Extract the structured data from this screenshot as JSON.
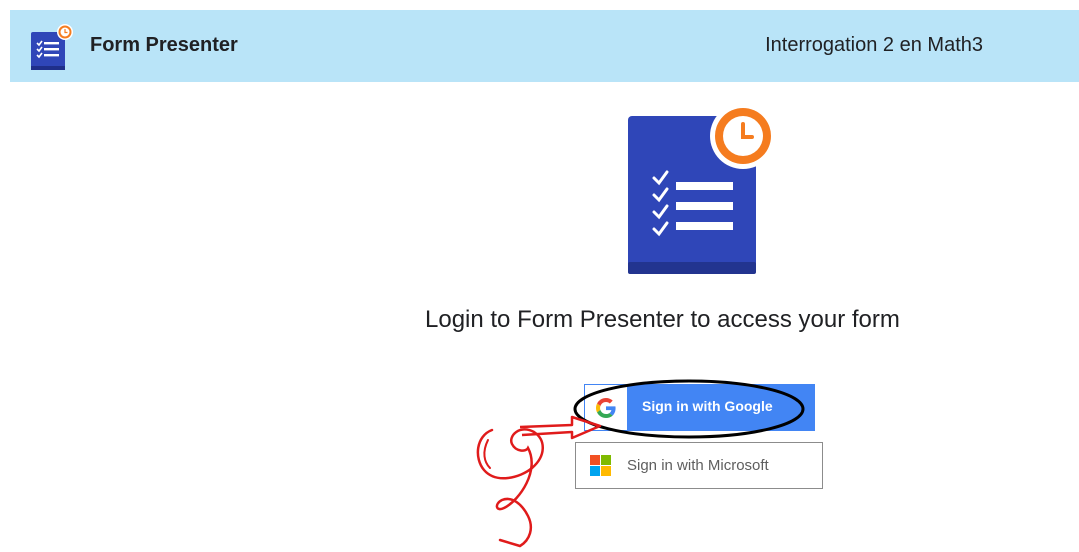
{
  "header": {
    "app_name": "Form Presenter",
    "form_title": "Interrogation 2 en Math3"
  },
  "login": {
    "heading": "Login to Form Presenter to access your form",
    "google_label": "Sign in with Google",
    "microsoft_label": "Sign in with Microsoft"
  },
  "colors": {
    "header_bg": "#b9e4f8",
    "google_blue": "#4285f4",
    "form_logo_blue": "#2f46b8",
    "clock_orange": "#f57c1f",
    "annotation_red": "#e01b1b",
    "annotation_black": "#000000"
  },
  "icons": {
    "app_logo": "form-presenter-icon",
    "google": "google-g-icon",
    "microsoft": "microsoft-logo-icon"
  }
}
